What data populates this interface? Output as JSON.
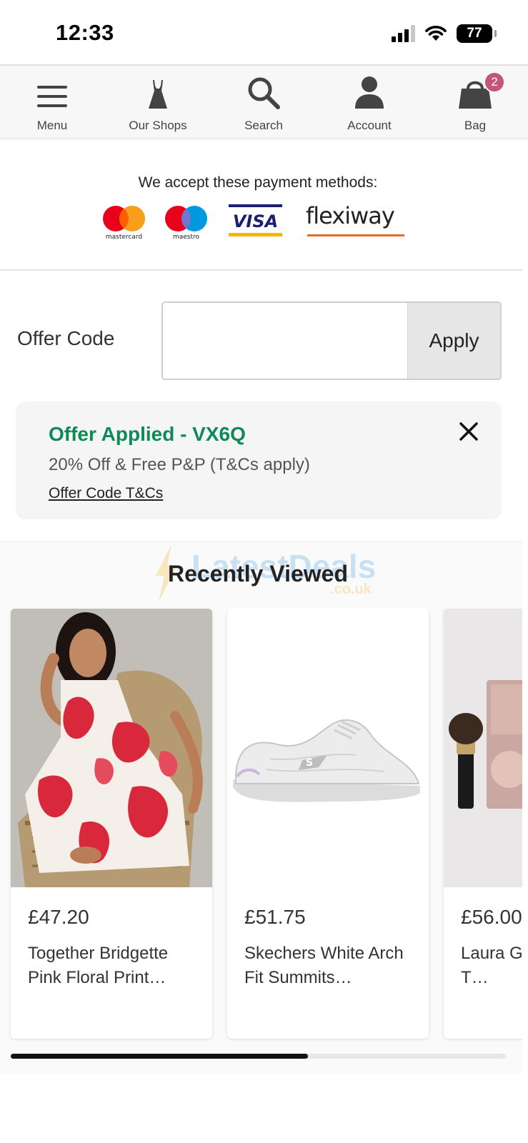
{
  "status_bar": {
    "time": "12:33",
    "battery": "77"
  },
  "nav": {
    "items": [
      {
        "label": "Menu",
        "icon": "hamburger-icon"
      },
      {
        "label": "Our Shops",
        "icon": "dress-icon"
      },
      {
        "label": "Search",
        "icon": "search-icon"
      },
      {
        "label": "Account",
        "icon": "user-icon"
      },
      {
        "label": "Bag",
        "icon": "bag-icon"
      }
    ],
    "bag_count": "2"
  },
  "payment": {
    "title": "We accept these payment methods:",
    "methods": [
      {
        "name": "mastercard",
        "label": "mastercard"
      },
      {
        "name": "maestro",
        "label": "maestro"
      },
      {
        "name": "visa",
        "label": "VISA"
      },
      {
        "name": "flexiway",
        "label": "flexiway"
      }
    ]
  },
  "offer": {
    "label": "Offer Code",
    "input_value": "",
    "apply_label": "Apply",
    "applied_title": "Offer Applied - VX6Q",
    "applied_description": "20% Off & Free P&P (T&Cs apply)",
    "tcs_link": "Offer Code T&Cs"
  },
  "recently_viewed": {
    "title": "Recently Viewed",
    "watermark": "LatestDeals",
    "watermark_sub": ".co.uk",
    "products": [
      {
        "price": "£47.20",
        "name": "Together Bridgette Pink Floral Print…"
      },
      {
        "price": "£51.75",
        "name": "Skechers White Arch Fit Summits…"
      },
      {
        "price": "£56.00",
        "name": "Laura Geller Best of T…"
      }
    ],
    "scroll_progress": 0.6
  },
  "colors": {
    "offer_green": "#0d8a57",
    "badge": "#c2567a",
    "mastercard_red": "#eb001b",
    "mastercard_orange": "#f79e1b",
    "maestro_blue": "#0099df",
    "visa_blue": "#1a1f71",
    "visa_gold": "#f7b600",
    "flexiway_orange": "#e8692a"
  }
}
